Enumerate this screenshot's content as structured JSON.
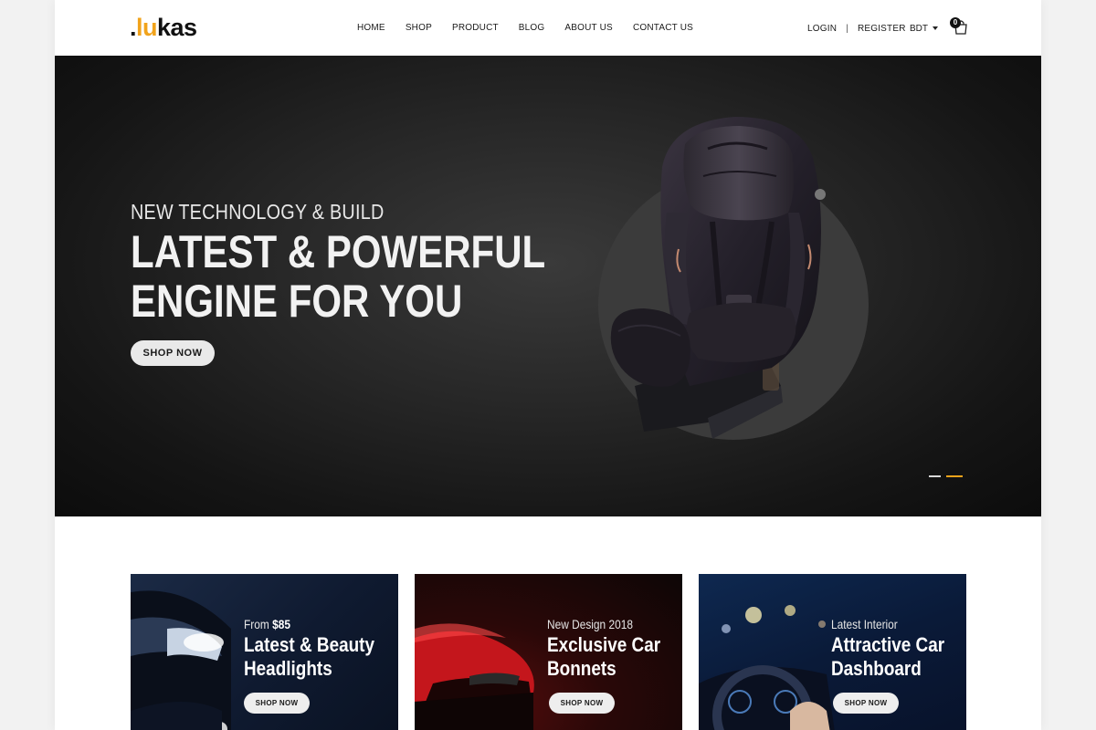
{
  "brand": {
    "dot": ".",
    "part1": "lu",
    "part2": "kas",
    "accent": "#f1a31b"
  },
  "nav": [
    "HOME",
    "SHOP",
    "PRODUCT",
    "BLOG",
    "ABOUT US",
    "CONTACT US"
  ],
  "account": {
    "login": "LOGIN",
    "separator": "|",
    "register": "REGISTER",
    "currency": "BDT",
    "cart_count": "0"
  },
  "hero": {
    "subtitle": "NEW TECHNOLOGY & BUILD",
    "title_line1": "LATEST & POWERFUL",
    "title_line2": "ENGINE FOR YOU",
    "button": "SHOP NOW",
    "slides": 2,
    "active_slide": 2,
    "product_image": "car-seat-image"
  },
  "banners": [
    {
      "sub_prefix": "From ",
      "sub_bold": "$85",
      "title_line1": "Latest & Beauty",
      "title_line2": "Headlights",
      "button": "SHOP NOW",
      "image": "car-headlight-image"
    },
    {
      "sub_prefix": "New Design 2018",
      "sub_bold": "",
      "title_line1": "Exclusive Car",
      "title_line2": "Bonnets",
      "button": "SHOP NOW",
      "image": "red-car-bonnet-image"
    },
    {
      "sub_prefix": "Latest Interior",
      "sub_bold": "",
      "title_line1": "Attractive Car",
      "title_line2": "Dashboard",
      "button": "SHOP NOW",
      "image": "car-dashboard-image"
    }
  ]
}
